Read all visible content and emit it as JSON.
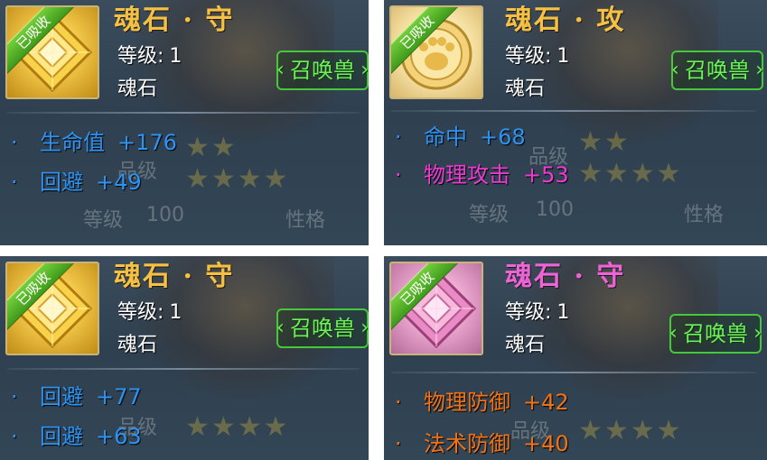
{
  "panels": [
    {
      "title": "魂石 · 守",
      "level_label": "等级:",
      "level_value": "1",
      "kind": "魂石",
      "ribbon": "已吸收",
      "summon_label": "召唤兽",
      "stats": [
        {
          "name": "生命值",
          "value": "+176",
          "color": "#2f93f2"
        },
        {
          "name": "回避",
          "value": "+49",
          "color": "#2f93f2"
        }
      ],
      "bg": {
        "level_text": "等级",
        "level_value": "100",
        "personality": "性格",
        "rank": "品级"
      }
    },
    {
      "title": "魂石 · 攻",
      "level_label": "等级:",
      "level_value": "1",
      "kind": "魂石",
      "ribbon": "已吸收",
      "summon_label": "召唤兽",
      "stats": [
        {
          "name": "命中",
          "value": "+68",
          "color": "#2f93f2"
        },
        {
          "name": "物理攻击",
          "value": "+53",
          "color": "#f13ad4"
        }
      ],
      "bg": {
        "level_text": "等级",
        "level_value": "100",
        "personality": "性格",
        "rank": "品级"
      }
    },
    {
      "title": "魂石 · 守",
      "level_label": "等级:",
      "level_value": "1",
      "kind": "魂石",
      "ribbon": "已吸收",
      "summon_label": "召唤兽",
      "stats": [
        {
          "name": "回避",
          "value": "+77",
          "color": "#2f93f2"
        },
        {
          "name": "回避",
          "value": "+63",
          "color": "#2f93f2"
        }
      ],
      "bg": {
        "rank": "品级"
      }
    },
    {
      "title": "魂石 · 守",
      "level_label": "等级:",
      "level_value": "1",
      "kind": "魂石",
      "ribbon": "已吸收",
      "summon_label": "召唤兽",
      "stats": [
        {
          "name": "物理防御",
          "value": "+42",
          "color": "#f27316"
        },
        {
          "name": "法术防御",
          "value": "+40",
          "color": "#f27316"
        }
      ],
      "bg": {
        "rank": "品级"
      }
    }
  ],
  "colors": {
    "title_gold": "#f6c143",
    "title_pink": "#ee63d6",
    "summon_green": "#6df05a",
    "ribbon_green": "#4caa22"
  },
  "icons": {
    "panel_0": "gold-diamond-gem-icon",
    "panel_1": "gold-round-paw-gem-icon",
    "panel_2": "gold-diamond-gem-icon",
    "panel_3": "pink-diamond-gem-icon"
  }
}
